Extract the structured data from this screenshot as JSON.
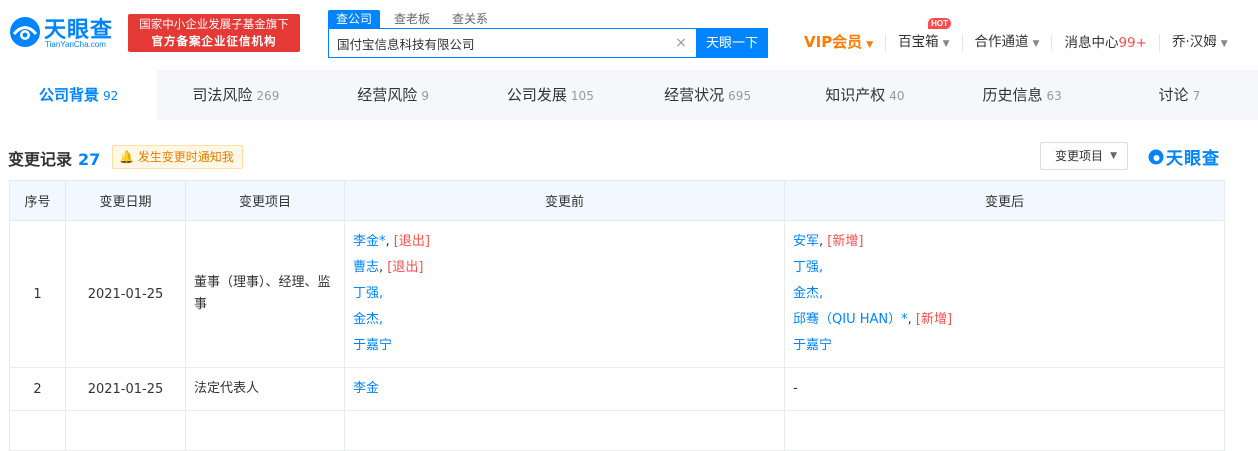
{
  "header": {
    "logo_name": "天眼查",
    "logo_sub": "TianYanCha.com",
    "gov_badge_line1": "国家中小企业发展子基金旗下",
    "gov_badge_line2": "官方备案企业征信机构",
    "search_tabs": [
      "查公司",
      "查老板",
      "查关系"
    ],
    "search_value": "国付宝信息科技有限公司",
    "search_button": "天眼一下",
    "nav": {
      "vip": "VIP会员",
      "baibaoxiang": "百宝箱",
      "hot": "HOT",
      "cooperation": "合作通道",
      "messages": "消息中心",
      "messages_count": "99+",
      "user": "乔·汉姆"
    }
  },
  "category_tabs": [
    {
      "label": "公司背景",
      "count": "92"
    },
    {
      "label": "司法风险",
      "count": "269"
    },
    {
      "label": "经营风险",
      "count": "9"
    },
    {
      "label": "公司发展",
      "count": "105"
    },
    {
      "label": "经营状况",
      "count": "695"
    },
    {
      "label": "知识产权",
      "count": "40"
    },
    {
      "label": "历史信息",
      "count": "63"
    },
    {
      "label": "讨论",
      "count": "7"
    }
  ],
  "section": {
    "title": "变更记录",
    "count": "27",
    "notify": "发生变更时通知我",
    "filter": "变更项目",
    "watermark": "天眼查"
  },
  "table": {
    "headers": [
      "序号",
      "变更日期",
      "变更项目",
      "变更前",
      "变更后"
    ],
    "rows": [
      {
        "no": "1",
        "date": "2021-01-25",
        "item": "董事（理事）、经理、监事",
        "before": [
          {
            "name": "李金*",
            "tag": "[退出]"
          },
          {
            "name": "曹志",
            "tag": "[退出]"
          },
          {
            "name": "丁强",
            "tag": ""
          },
          {
            "name": "金杰",
            "tag": ""
          },
          {
            "name": "于嘉宁",
            "tag": ""
          }
        ],
        "after": [
          {
            "name": "安军",
            "tag": "[新增]"
          },
          {
            "name": "丁强",
            "tag": ""
          },
          {
            "name": "金杰",
            "tag": ""
          },
          {
            "name": "邱骞（QIU HAN）*",
            "tag": "[新增]"
          },
          {
            "name": "于嘉宁",
            "tag": ""
          }
        ]
      },
      {
        "no": "2",
        "date": "2021-01-25",
        "item": "法定代表人",
        "before": "李金",
        "after": "-"
      }
    ]
  },
  "colors": {
    "brand": "#0084ff",
    "badge_red": "#e53935",
    "vip_orange": "#ff7a00",
    "tag_red": "#ff4d4f"
  }
}
